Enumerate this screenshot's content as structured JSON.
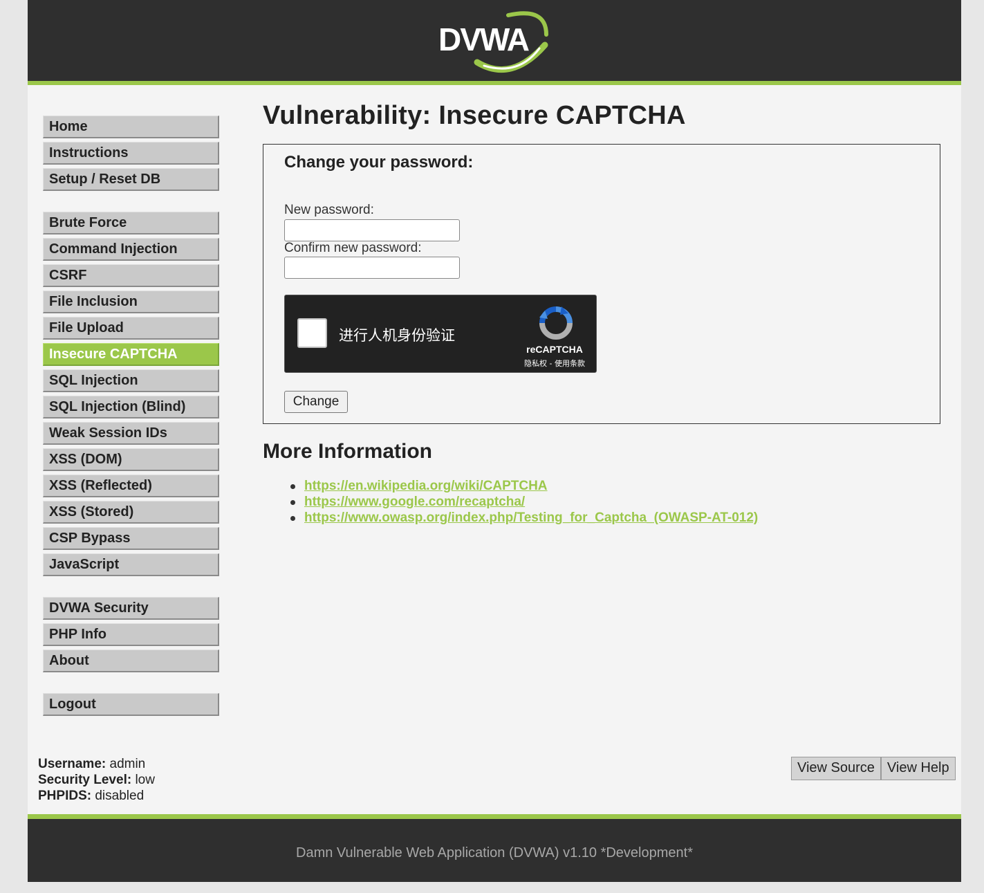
{
  "header": {
    "logo_text": "DVWA",
    "accent_color": "#9bc74a",
    "background_color": "#2f2f2f"
  },
  "menu": {
    "group1": [
      {
        "label": "Home"
      },
      {
        "label": "Instructions"
      },
      {
        "label": "Setup / Reset DB"
      }
    ],
    "group2": [
      {
        "label": "Brute Force"
      },
      {
        "label": "Command Injection"
      },
      {
        "label": "CSRF"
      },
      {
        "label": "File Inclusion"
      },
      {
        "label": "File Upload"
      },
      {
        "label": "Insecure CAPTCHA",
        "selected": true
      },
      {
        "label": "SQL Injection"
      },
      {
        "label": "SQL Injection (Blind)"
      },
      {
        "label": "Weak Session IDs"
      },
      {
        "label": "XSS (DOM)"
      },
      {
        "label": "XSS (Reflected)"
      },
      {
        "label": "XSS (Stored)"
      },
      {
        "label": "CSP Bypass"
      },
      {
        "label": "JavaScript"
      }
    ],
    "group3": [
      {
        "label": "DVWA Security"
      },
      {
        "label": "PHP Info"
      },
      {
        "label": "About"
      }
    ],
    "group4": [
      {
        "label": "Logout"
      }
    ]
  },
  "main": {
    "title": "Vulnerability: Insecure CAPTCHA",
    "form": {
      "heading": "Change your password:",
      "new_password_label": "New password:",
      "new_password_value": "",
      "confirm_password_label": "Confirm new password:",
      "confirm_password_value": "",
      "submit_label": "Change"
    },
    "recaptcha": {
      "checkbox_label": "进行人机身份验证",
      "brand": "reCAPTCHA",
      "terms": "隐私权 - 使用条款"
    },
    "more_info": {
      "title": "More Information",
      "links": [
        "https://en.wikipedia.org/wiki/CAPTCHA",
        "https://www.google.com/recaptcha/",
        "https://www.owasp.org/index.php/Testing_for_Captcha_(OWASP-AT-012)"
      ]
    }
  },
  "system_info": {
    "username_label": "Username:",
    "username": "admin",
    "security_label": "Security Level:",
    "security": "low",
    "phpids_label": "PHPIDS:",
    "phpids": "disabled"
  },
  "help": {
    "view_source": "View Source",
    "view_help": "View Help"
  },
  "footer": {
    "text": "Damn Vulnerable Web Application (DVWA) v1.10 *Development*"
  }
}
